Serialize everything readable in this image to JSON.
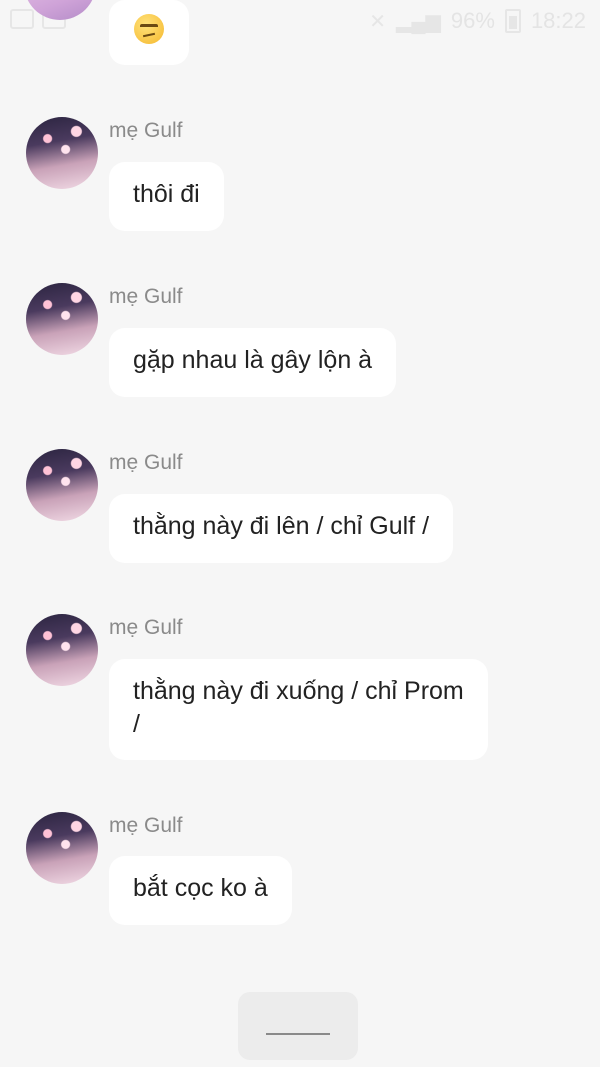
{
  "status_bar": {
    "battery": "96%",
    "time": "18:22"
  },
  "messages": [
    {
      "sender": "mẹ Gulf",
      "text": "thôi đi"
    },
    {
      "sender": "mẹ Gulf",
      "text": "gặp nhau là gây lộn à"
    },
    {
      "sender": "mẹ Gulf",
      "text": "thằng này đi lên / chỉ Gulf /"
    },
    {
      "sender": "mẹ Gulf",
      "text": "thằng này đi xuống / chỉ Prom /"
    },
    {
      "sender": "mẹ Gulf",
      "text": "bắt cọc ko à"
    }
  ],
  "top_emoji": "unamused-face-emoji"
}
